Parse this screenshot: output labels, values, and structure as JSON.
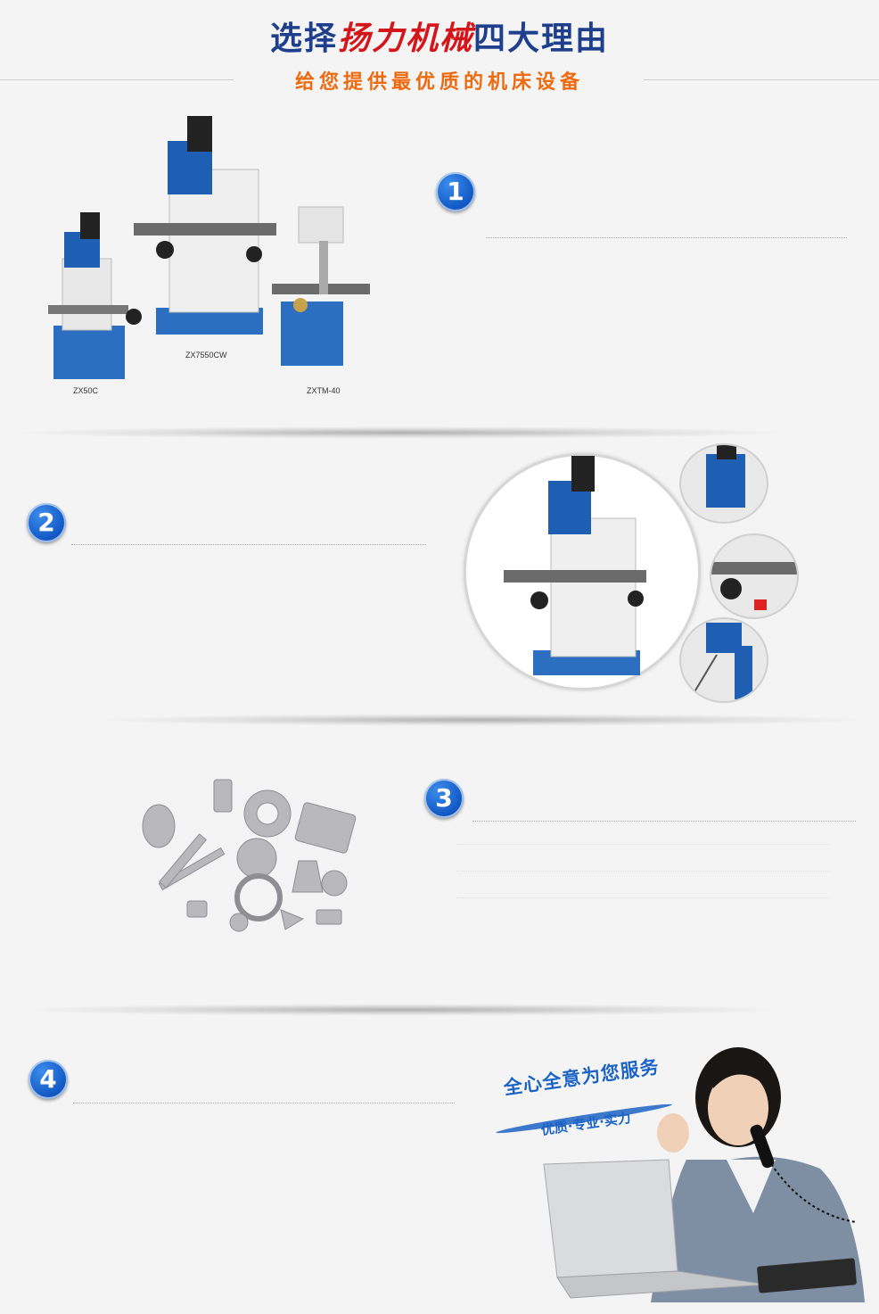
{
  "header": {
    "title_prefix": "选择",
    "title_brand": "扬力机械",
    "title_suffix": "四大理由",
    "subtitle": "给您提供最优质的机床设备"
  },
  "reasons": [
    {
      "number": "1"
    },
    {
      "number": "2"
    },
    {
      "number": "3"
    },
    {
      "number": "4"
    }
  ],
  "products": {
    "machine_left": "ZX50C",
    "machine_center": "ZX7550CW",
    "machine_right": "ZXTM-40"
  },
  "service": {
    "slogan_main": "全心全意为您服务",
    "slogan_sub": "优质·专业·实力"
  },
  "colors": {
    "title_blue": "#1d3f8c",
    "brand_red": "#d4151a",
    "subtitle_orange": "#ee6a10",
    "badge_blue": "#0f56c2"
  }
}
